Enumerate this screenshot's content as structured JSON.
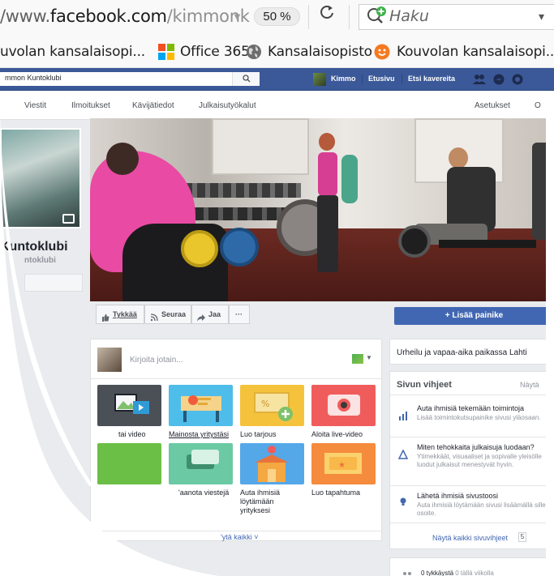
{
  "browser": {
    "url_prefix": "/www.",
    "url_domain": "facebook.com",
    "url_path": "/kimmonk",
    "zoom": "50 %",
    "search_placeholder": "Haku",
    "bookmarks": [
      {
        "label": "uvolan kansalaisopi...",
        "icon": "none"
      },
      {
        "label": "Office 365",
        "icon": "office-icon"
      },
      {
        "label": "Kansalaisopisto",
        "icon": "globe-icon"
      },
      {
        "label": "Kouvolan kansalaisopi...",
        "icon": "orange-face-icon"
      }
    ]
  },
  "fb": {
    "search_value": "mmon Kuntoklubi",
    "nav": {
      "user": "Kimmo",
      "home": "Etusivu",
      "find_friends": "Etsi kavereita"
    },
    "tabs": [
      "Viestit",
      "Ilmoitukset",
      "Kävijätiedot",
      "Julkaisutyökalut",
      "Asetukset",
      "O"
    ],
    "page_name": "Kuntoklubi",
    "page_handle": "ntoklubi",
    "actions": {
      "like": "Tykkää",
      "follow": "Seuraa",
      "share": "Jaa",
      "more": "···"
    },
    "add_button": "+ Lisää painike",
    "composer": {
      "placeholder": "Kirjoita jotain...",
      "tiles": [
        {
          "label": "tai video",
          "icon": "photo-video-icon",
          "color": "#4b4f56"
        },
        {
          "label": "Mainosta yritystäsi",
          "icon": "promote-icon",
          "color": "#4fbde9"
        },
        {
          "label": "Luo tarjous",
          "icon": "offer-icon",
          "color": "#f5c33b"
        },
        {
          "label": "Aloita live-video",
          "icon": "live-video-icon",
          "color": "#f05c5c"
        },
        {
          "label": "",
          "icon": "green-icon",
          "color": "#6bbf46"
        },
        {
          "label": "'aanota viestejä",
          "icon": "message-icon",
          "color": "#6bc9a3"
        },
        {
          "label": "Auta ihmisiä löytämään yrityksesi",
          "icon": "store-icon",
          "color": "#55a8e8"
        },
        {
          "label": "Luo tapahtuma",
          "icon": "event-icon",
          "color": "#f58b3c"
        }
      ],
      "show_all": "'ytä kaikki ˅"
    },
    "category": "Urheilu ja vapaa-aika paikassa Lahti",
    "tips": {
      "title": "Sivun vihjeet",
      "show_all": "Näytä",
      "items": [
        {
          "title": "Auta ihmisiä tekemään toimintoja",
          "desc": "Lisää toimintokutsupainike sivusi yläosaan."
        },
        {
          "title": "Miten tehokkaita julkaisuja luodaan?",
          "desc": "Ytimekkäät, visuaaliset ja sopivalle yleisölle luodut julkaisut menestyvät hyvin."
        },
        {
          "title": "Lähetä ihmisiä sivustoosi",
          "desc": "Auta ihmisiä löytämään sivusi lisäämällä sille osoite."
        }
      ],
      "footer": "Näytä kaikki sivuvihjeet",
      "count": "5"
    },
    "likes": {
      "count_text": "0 tykkäystä",
      "week_text": "0 tällä viikolla"
    }
  }
}
